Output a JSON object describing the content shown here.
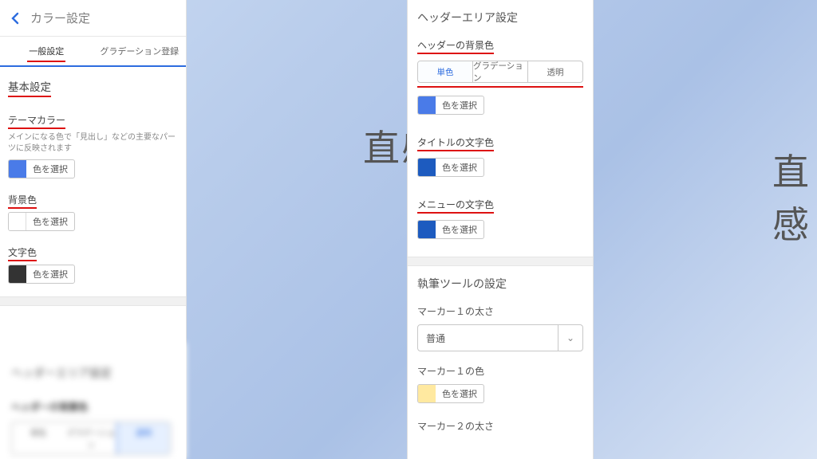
{
  "bg": {
    "left": "直感",
    "right": "直感"
  },
  "left_panel": {
    "title": "カラー設定",
    "tabs": [
      "一般設定",
      "グラデーション登録"
    ],
    "section_basic": "基本設定",
    "theme": {
      "label": "テーマカラー",
      "help": "メインになる色で「見出し」などの主要なパーツに反映されます",
      "swatch": "#4a7be8",
      "btn": "色を選択"
    },
    "bgcolor": {
      "label": "背景色",
      "swatch": "#ffffff",
      "btn": "色を選択"
    },
    "textcolor": {
      "label": "文字色",
      "swatch": "#333333",
      "btn": "色を選択"
    },
    "blur": {
      "section": "ヘッダーエリア設定",
      "sub": "ヘッダーの背景色",
      "seg": [
        "単色",
        "グラデーション",
        "透明"
      ]
    }
  },
  "right_panel": {
    "header_section": "ヘッダーエリア設定",
    "header_bg": {
      "label": "ヘッダーの背景色",
      "seg": [
        "単色",
        "グラデーション",
        "透明"
      ],
      "swatch": "#4a7be8",
      "btn": "色を選択"
    },
    "title_color": {
      "label": "タイトルの文字色",
      "swatch": "#1d5bbf",
      "btn": "色を選択"
    },
    "menu_color": {
      "label": "メニューの文字色",
      "swatch": "#1d5bbf",
      "btn": "色を選択"
    },
    "writing_section": "執筆ツールの設定",
    "marker1_thick": {
      "label": "マーカー１の太さ",
      "value": "普通"
    },
    "marker1_color": {
      "label": "マーカー１の色",
      "swatch": "#ffe9a0",
      "btn": "色を選択"
    },
    "marker2_thick": {
      "label": "マーカー２の太さ"
    }
  }
}
